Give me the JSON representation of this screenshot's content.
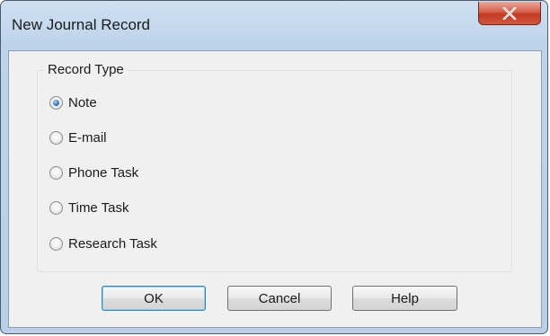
{
  "window": {
    "title": "New Journal Record",
    "close_icon": "close-icon"
  },
  "record_type": {
    "legend": "Record Type",
    "options": [
      {
        "label": "Note",
        "checked": true
      },
      {
        "label": "E-mail",
        "checked": false
      },
      {
        "label": "Phone Task",
        "checked": false
      },
      {
        "label": "Time Task",
        "checked": false
      },
      {
        "label": "Research Task",
        "checked": false
      }
    ]
  },
  "buttons": {
    "ok": "OK",
    "cancel": "Cancel",
    "help": "Help"
  },
  "colors": {
    "titlebar": "#bcd3ea",
    "close_button": "#c23a22",
    "dialog_background": "#f0f0f0",
    "radio_selected": "#2f6fbd"
  }
}
